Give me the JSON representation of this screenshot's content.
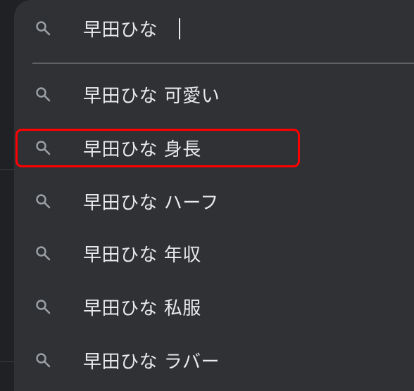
{
  "search": {
    "query": "早田ひな"
  },
  "suggestions": [
    {
      "text": "早田ひな 可愛い"
    },
    {
      "text": "早田ひな 身長"
    },
    {
      "text": "早田ひな ハーフ"
    },
    {
      "text": "早田ひな 年収"
    },
    {
      "text": "早田ひな 私服"
    },
    {
      "text": "早田ひな ラバー"
    }
  ],
  "colors": {
    "background": "#202124",
    "dropdown": "#303134",
    "text": "#e8eaed",
    "icon": "#9aa0a6",
    "highlight": "#ff0000"
  },
  "icons": {
    "search": "search-icon"
  }
}
